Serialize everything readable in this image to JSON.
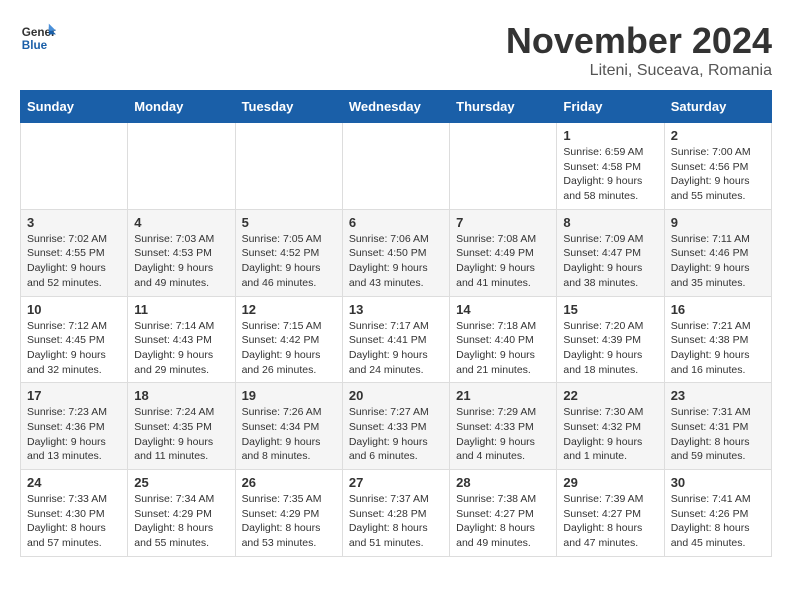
{
  "header": {
    "logo_line1": "General",
    "logo_line2": "Blue",
    "month": "November 2024",
    "location": "Liteni, Suceava, Romania"
  },
  "weekdays": [
    "Sunday",
    "Monday",
    "Tuesday",
    "Wednesday",
    "Thursday",
    "Friday",
    "Saturday"
  ],
  "weeks": [
    [
      {
        "day": "",
        "info": ""
      },
      {
        "day": "",
        "info": ""
      },
      {
        "day": "",
        "info": ""
      },
      {
        "day": "",
        "info": ""
      },
      {
        "day": "",
        "info": ""
      },
      {
        "day": "1",
        "info": "Sunrise: 6:59 AM\nSunset: 4:58 PM\nDaylight: 9 hours\nand 58 minutes."
      },
      {
        "day": "2",
        "info": "Sunrise: 7:00 AM\nSunset: 4:56 PM\nDaylight: 9 hours\nand 55 minutes."
      }
    ],
    [
      {
        "day": "3",
        "info": "Sunrise: 7:02 AM\nSunset: 4:55 PM\nDaylight: 9 hours\nand 52 minutes."
      },
      {
        "day": "4",
        "info": "Sunrise: 7:03 AM\nSunset: 4:53 PM\nDaylight: 9 hours\nand 49 minutes."
      },
      {
        "day": "5",
        "info": "Sunrise: 7:05 AM\nSunset: 4:52 PM\nDaylight: 9 hours\nand 46 minutes."
      },
      {
        "day": "6",
        "info": "Sunrise: 7:06 AM\nSunset: 4:50 PM\nDaylight: 9 hours\nand 43 minutes."
      },
      {
        "day": "7",
        "info": "Sunrise: 7:08 AM\nSunset: 4:49 PM\nDaylight: 9 hours\nand 41 minutes."
      },
      {
        "day": "8",
        "info": "Sunrise: 7:09 AM\nSunset: 4:47 PM\nDaylight: 9 hours\nand 38 minutes."
      },
      {
        "day": "9",
        "info": "Sunrise: 7:11 AM\nSunset: 4:46 PM\nDaylight: 9 hours\nand 35 minutes."
      }
    ],
    [
      {
        "day": "10",
        "info": "Sunrise: 7:12 AM\nSunset: 4:45 PM\nDaylight: 9 hours\nand 32 minutes."
      },
      {
        "day": "11",
        "info": "Sunrise: 7:14 AM\nSunset: 4:43 PM\nDaylight: 9 hours\nand 29 minutes."
      },
      {
        "day": "12",
        "info": "Sunrise: 7:15 AM\nSunset: 4:42 PM\nDaylight: 9 hours\nand 26 minutes."
      },
      {
        "day": "13",
        "info": "Sunrise: 7:17 AM\nSunset: 4:41 PM\nDaylight: 9 hours\nand 24 minutes."
      },
      {
        "day": "14",
        "info": "Sunrise: 7:18 AM\nSunset: 4:40 PM\nDaylight: 9 hours\nand 21 minutes."
      },
      {
        "day": "15",
        "info": "Sunrise: 7:20 AM\nSunset: 4:39 PM\nDaylight: 9 hours\nand 18 minutes."
      },
      {
        "day": "16",
        "info": "Sunrise: 7:21 AM\nSunset: 4:38 PM\nDaylight: 9 hours\nand 16 minutes."
      }
    ],
    [
      {
        "day": "17",
        "info": "Sunrise: 7:23 AM\nSunset: 4:36 PM\nDaylight: 9 hours\nand 13 minutes."
      },
      {
        "day": "18",
        "info": "Sunrise: 7:24 AM\nSunset: 4:35 PM\nDaylight: 9 hours\nand 11 minutes."
      },
      {
        "day": "19",
        "info": "Sunrise: 7:26 AM\nSunset: 4:34 PM\nDaylight: 9 hours\nand 8 minutes."
      },
      {
        "day": "20",
        "info": "Sunrise: 7:27 AM\nSunset: 4:33 PM\nDaylight: 9 hours\nand 6 minutes."
      },
      {
        "day": "21",
        "info": "Sunrise: 7:29 AM\nSunset: 4:33 PM\nDaylight: 9 hours\nand 4 minutes."
      },
      {
        "day": "22",
        "info": "Sunrise: 7:30 AM\nSunset: 4:32 PM\nDaylight: 9 hours\nand 1 minute."
      },
      {
        "day": "23",
        "info": "Sunrise: 7:31 AM\nSunset: 4:31 PM\nDaylight: 8 hours\nand 59 minutes."
      }
    ],
    [
      {
        "day": "24",
        "info": "Sunrise: 7:33 AM\nSunset: 4:30 PM\nDaylight: 8 hours\nand 57 minutes."
      },
      {
        "day": "25",
        "info": "Sunrise: 7:34 AM\nSunset: 4:29 PM\nDaylight: 8 hours\nand 55 minutes."
      },
      {
        "day": "26",
        "info": "Sunrise: 7:35 AM\nSunset: 4:29 PM\nDaylight: 8 hours\nand 53 minutes."
      },
      {
        "day": "27",
        "info": "Sunrise: 7:37 AM\nSunset: 4:28 PM\nDaylight: 8 hours\nand 51 minutes."
      },
      {
        "day": "28",
        "info": "Sunrise: 7:38 AM\nSunset: 4:27 PM\nDaylight: 8 hours\nand 49 minutes."
      },
      {
        "day": "29",
        "info": "Sunrise: 7:39 AM\nSunset: 4:27 PM\nDaylight: 8 hours\nand 47 minutes."
      },
      {
        "day": "30",
        "info": "Sunrise: 7:41 AM\nSunset: 4:26 PM\nDaylight: 8 hours\nand 45 minutes."
      }
    ]
  ]
}
